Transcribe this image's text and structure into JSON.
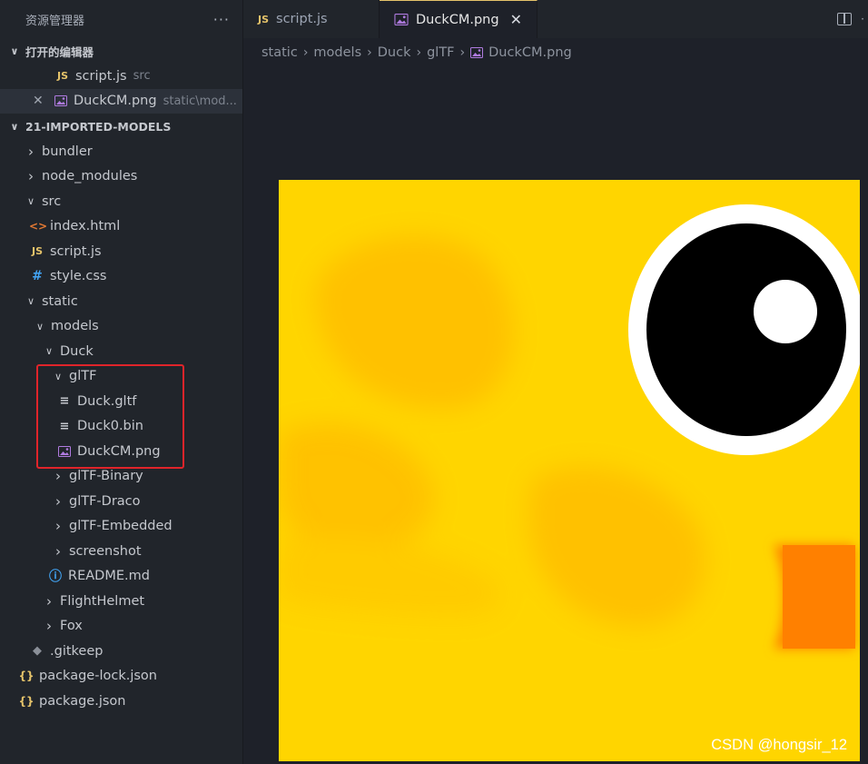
{
  "explorer": {
    "title": "资源管理器",
    "more": "···"
  },
  "open_editors": {
    "header": "打开的编辑器",
    "items": [
      {
        "name": "script.js",
        "path": "src",
        "icon": "js"
      },
      {
        "name": "DuckCM.png",
        "path": "static\\mod...",
        "icon": "image"
      }
    ]
  },
  "project": {
    "header": "21-IMPORTED-MODELS",
    "tree": [
      {
        "label": "bundler"
      },
      {
        "label": "node_modules"
      },
      {
        "label": "src"
      },
      {
        "label": "index.html",
        "icon": "<>"
      },
      {
        "label": "script.js",
        "icon": "JS"
      },
      {
        "label": "style.css",
        "icon": "#"
      },
      {
        "label": "static"
      },
      {
        "label": "models"
      },
      {
        "label": "Duck"
      },
      {
        "label": "glTF"
      },
      {
        "label": "Duck.gltf",
        "icon": "≡"
      },
      {
        "label": "Duck0.bin",
        "icon": "≡"
      },
      {
        "label": "DuckCM.png"
      },
      {
        "label": "glTF-Binary"
      },
      {
        "label": "glTF-Draco"
      },
      {
        "label": "glTF-Embedded"
      },
      {
        "label": "screenshot"
      },
      {
        "label": "README.md",
        "icon": "ⓘ"
      },
      {
        "label": "FlightHelmet"
      },
      {
        "label": "Fox"
      },
      {
        "label": ".gitkeep",
        "icon": "◆"
      },
      {
        "label": "package-lock.json",
        "icon": "{}"
      },
      {
        "label": "package.json",
        "icon": "{}"
      }
    ]
  },
  "tabs": [
    {
      "label": "script.js",
      "icon": "JS"
    },
    {
      "label": "DuckCM.png",
      "close": "✕"
    }
  ],
  "breadcrumb": [
    "static",
    "models",
    "Duck",
    "glTF",
    "DuckCM.png"
  ],
  "watermark": "CSDN @hongsir_12",
  "colors": {
    "highlight_box": "#e0242a",
    "texture_yellow": "#ffd500",
    "texture_orange": "#ff8000",
    "js_icon": "#e5c36a",
    "image_icon": "#b07be0"
  }
}
